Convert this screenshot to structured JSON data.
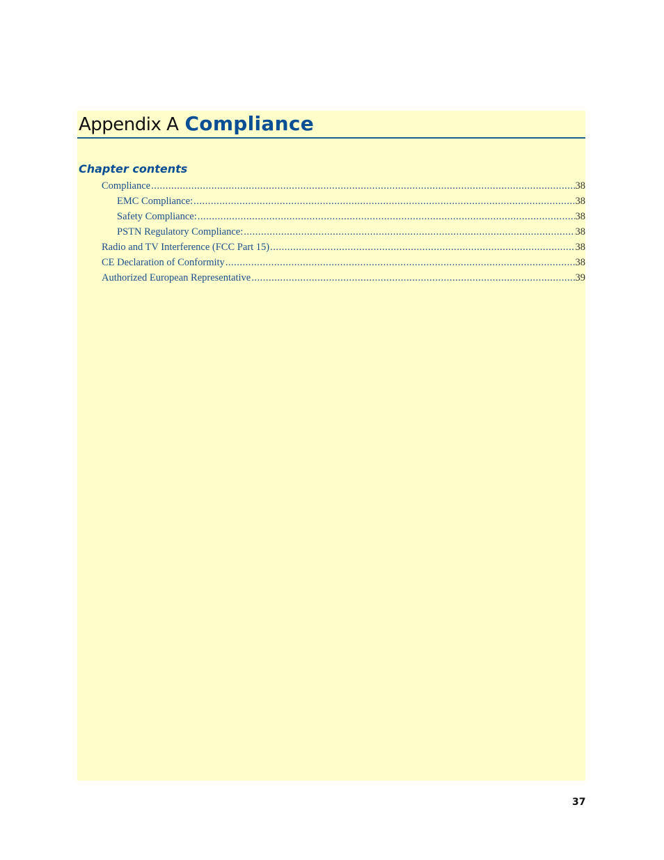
{
  "heading": {
    "prefix": "Appendix A",
    "title": "Compliance"
  },
  "chapter_contents_label": "Chapter contents",
  "toc": [
    {
      "label": "Compliance",
      "page": "38",
      "level": 1
    },
    {
      "label": "EMC Compliance:",
      "page": "38",
      "level": 2
    },
    {
      "label": "Safety Compliance:",
      "page": "38",
      "level": 2
    },
    {
      "label": "PSTN Regulatory Compliance:",
      "page": "38",
      "level": 2
    },
    {
      "label": "Radio and TV Interference (FCC Part 15)",
      "page": "38",
      "level": 1
    },
    {
      "label": "CE Declaration of Conformity",
      "page": "38",
      "level": 1
    },
    {
      "label": "Authorized European Representative",
      "page": "39",
      "level": 1
    }
  ],
  "page_number": "37",
  "colors": {
    "accent": "#0a4f94",
    "panel_background": "#ffffcc",
    "rule": "#1b5d8f"
  }
}
